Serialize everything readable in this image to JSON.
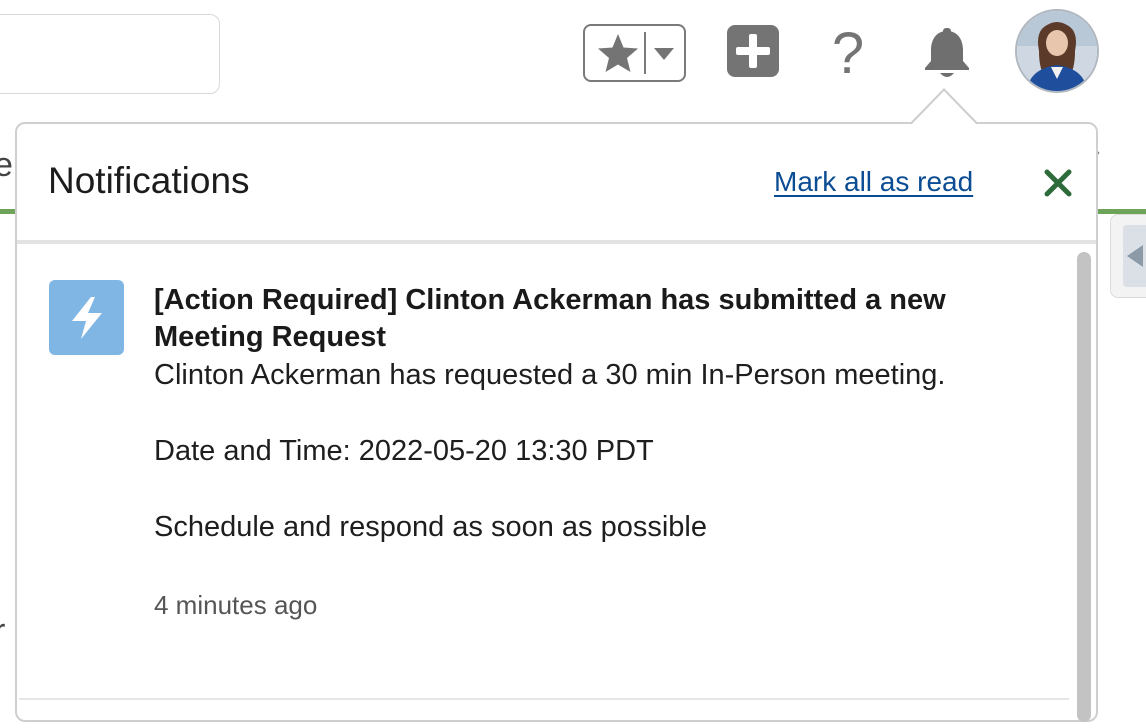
{
  "background": {
    "letter_top": "e",
    "letter_bottom": "r",
    "accent_green": "#6ea35a"
  },
  "header": {
    "favorites_icon": "star-icon",
    "favorites_menu_icon": "chevron-down-icon",
    "add_icon": "plus-square-icon",
    "help_icon": "question-mark-icon",
    "help_glyph": "?",
    "notifications_icon": "bell-icon",
    "icon_color": "#747474"
  },
  "notifications": {
    "title": "Notifications",
    "mark_all_label": "Mark all as read",
    "close_icon": "close-icon",
    "link_color": "#0b4c93",
    "close_color": "#2e6b3a",
    "items": [
      {
        "icon": "lightning-bolt-icon",
        "icon_color": "#80b6e4",
        "title": "[Action Required] Clinton Ackerman has submitted a new Meeting Request",
        "line1": "Clinton Ackerman has requested a 30 min In-Person meeting.",
        "line2": "Date and Time: 2022-05-20 13:30 PDT",
        "line3": "Schedule and respond as soon as possible",
        "time": "4 minutes ago"
      }
    ]
  }
}
